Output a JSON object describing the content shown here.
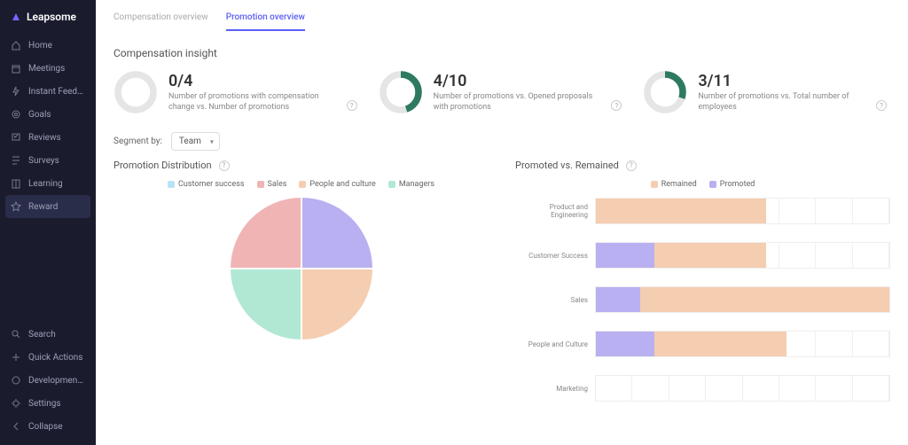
{
  "brand": {
    "name": "Leapsome"
  },
  "sidebar": {
    "top": [
      {
        "icon": "home",
        "label": "Home"
      },
      {
        "icon": "calendar",
        "label": "Meetings"
      },
      {
        "icon": "bolt",
        "label": "Instant Feedback"
      },
      {
        "icon": "target",
        "label": "Goals"
      },
      {
        "icon": "review",
        "label": "Reviews"
      },
      {
        "icon": "survey",
        "label": "Surveys"
      },
      {
        "icon": "book",
        "label": "Learning"
      },
      {
        "icon": "reward",
        "label": "Reward"
      }
    ],
    "bottom": [
      {
        "icon": "search",
        "label": "Search"
      },
      {
        "icon": "plus",
        "label": "Quick Actions"
      },
      {
        "icon": "dev",
        "label": "Development Fr..."
      },
      {
        "icon": "gear",
        "label": "Settings"
      },
      {
        "icon": "collapse",
        "label": "Collapse"
      }
    ],
    "active_index": 7
  },
  "tabs": {
    "items": [
      "Compensation overview",
      "Promotion overview"
    ],
    "active_index": 1
  },
  "insight_section_title": "Compensation insight",
  "insights": [
    {
      "value": "0/4",
      "desc": "Number of promotions with compensation change vs. Number of promotions",
      "pct": 0
    },
    {
      "value": "4/10",
      "desc": "Number of promotions vs. Opened proposals with promotions",
      "pct": 40
    },
    {
      "value": "3/11",
      "desc": "Number of promotions vs. Total number of employees",
      "pct": 27
    }
  ],
  "segment": {
    "label": "Segment by:",
    "value": "Team"
  },
  "colors": {
    "customer_success": "#b8e3f5",
    "sales": "#f0b4b4",
    "people_culture": "#f5cdb0",
    "managers": "#b0e8d4",
    "remained": "#f5cdb0",
    "promoted": "#b8b0f0",
    "donut_track": "#e5e5e5",
    "donut_fill": "#2d7a5f"
  },
  "chart_data": [
    {
      "type": "pie",
      "title": "Promotion Distribution",
      "series": [
        {
          "name": "Customer success",
          "value": 25,
          "color": "#b8e3f5"
        },
        {
          "name": "Sales",
          "value": 25,
          "color": "#f0b4b4"
        },
        {
          "name": "People and culture",
          "value": 25,
          "color": "#f5cdb0"
        },
        {
          "name": "Managers",
          "value": 25,
          "color": "#b0e8d4"
        }
      ],
      "legend": [
        "Customer success",
        "Sales",
        "People and culture",
        "Managers"
      ]
    },
    {
      "type": "bar",
      "title": "Promoted vs. Remained",
      "orientation": "horizontal",
      "stacked": true,
      "legend": [
        "Remained",
        "Promoted"
      ],
      "categories": [
        "Product and Engineering",
        "Customer Success",
        "Sales",
        "People and Culture",
        "Marketing"
      ],
      "series": [
        {
          "name": "Promoted",
          "color": "#b8b0f0",
          "values": [
            0,
            20,
            15,
            20,
            0
          ]
        },
        {
          "name": "Remained",
          "color": "#f5cdb0",
          "values": [
            58,
            38,
            85,
            45,
            0
          ]
        }
      ],
      "xlim": [
        0,
        100
      ]
    }
  ]
}
